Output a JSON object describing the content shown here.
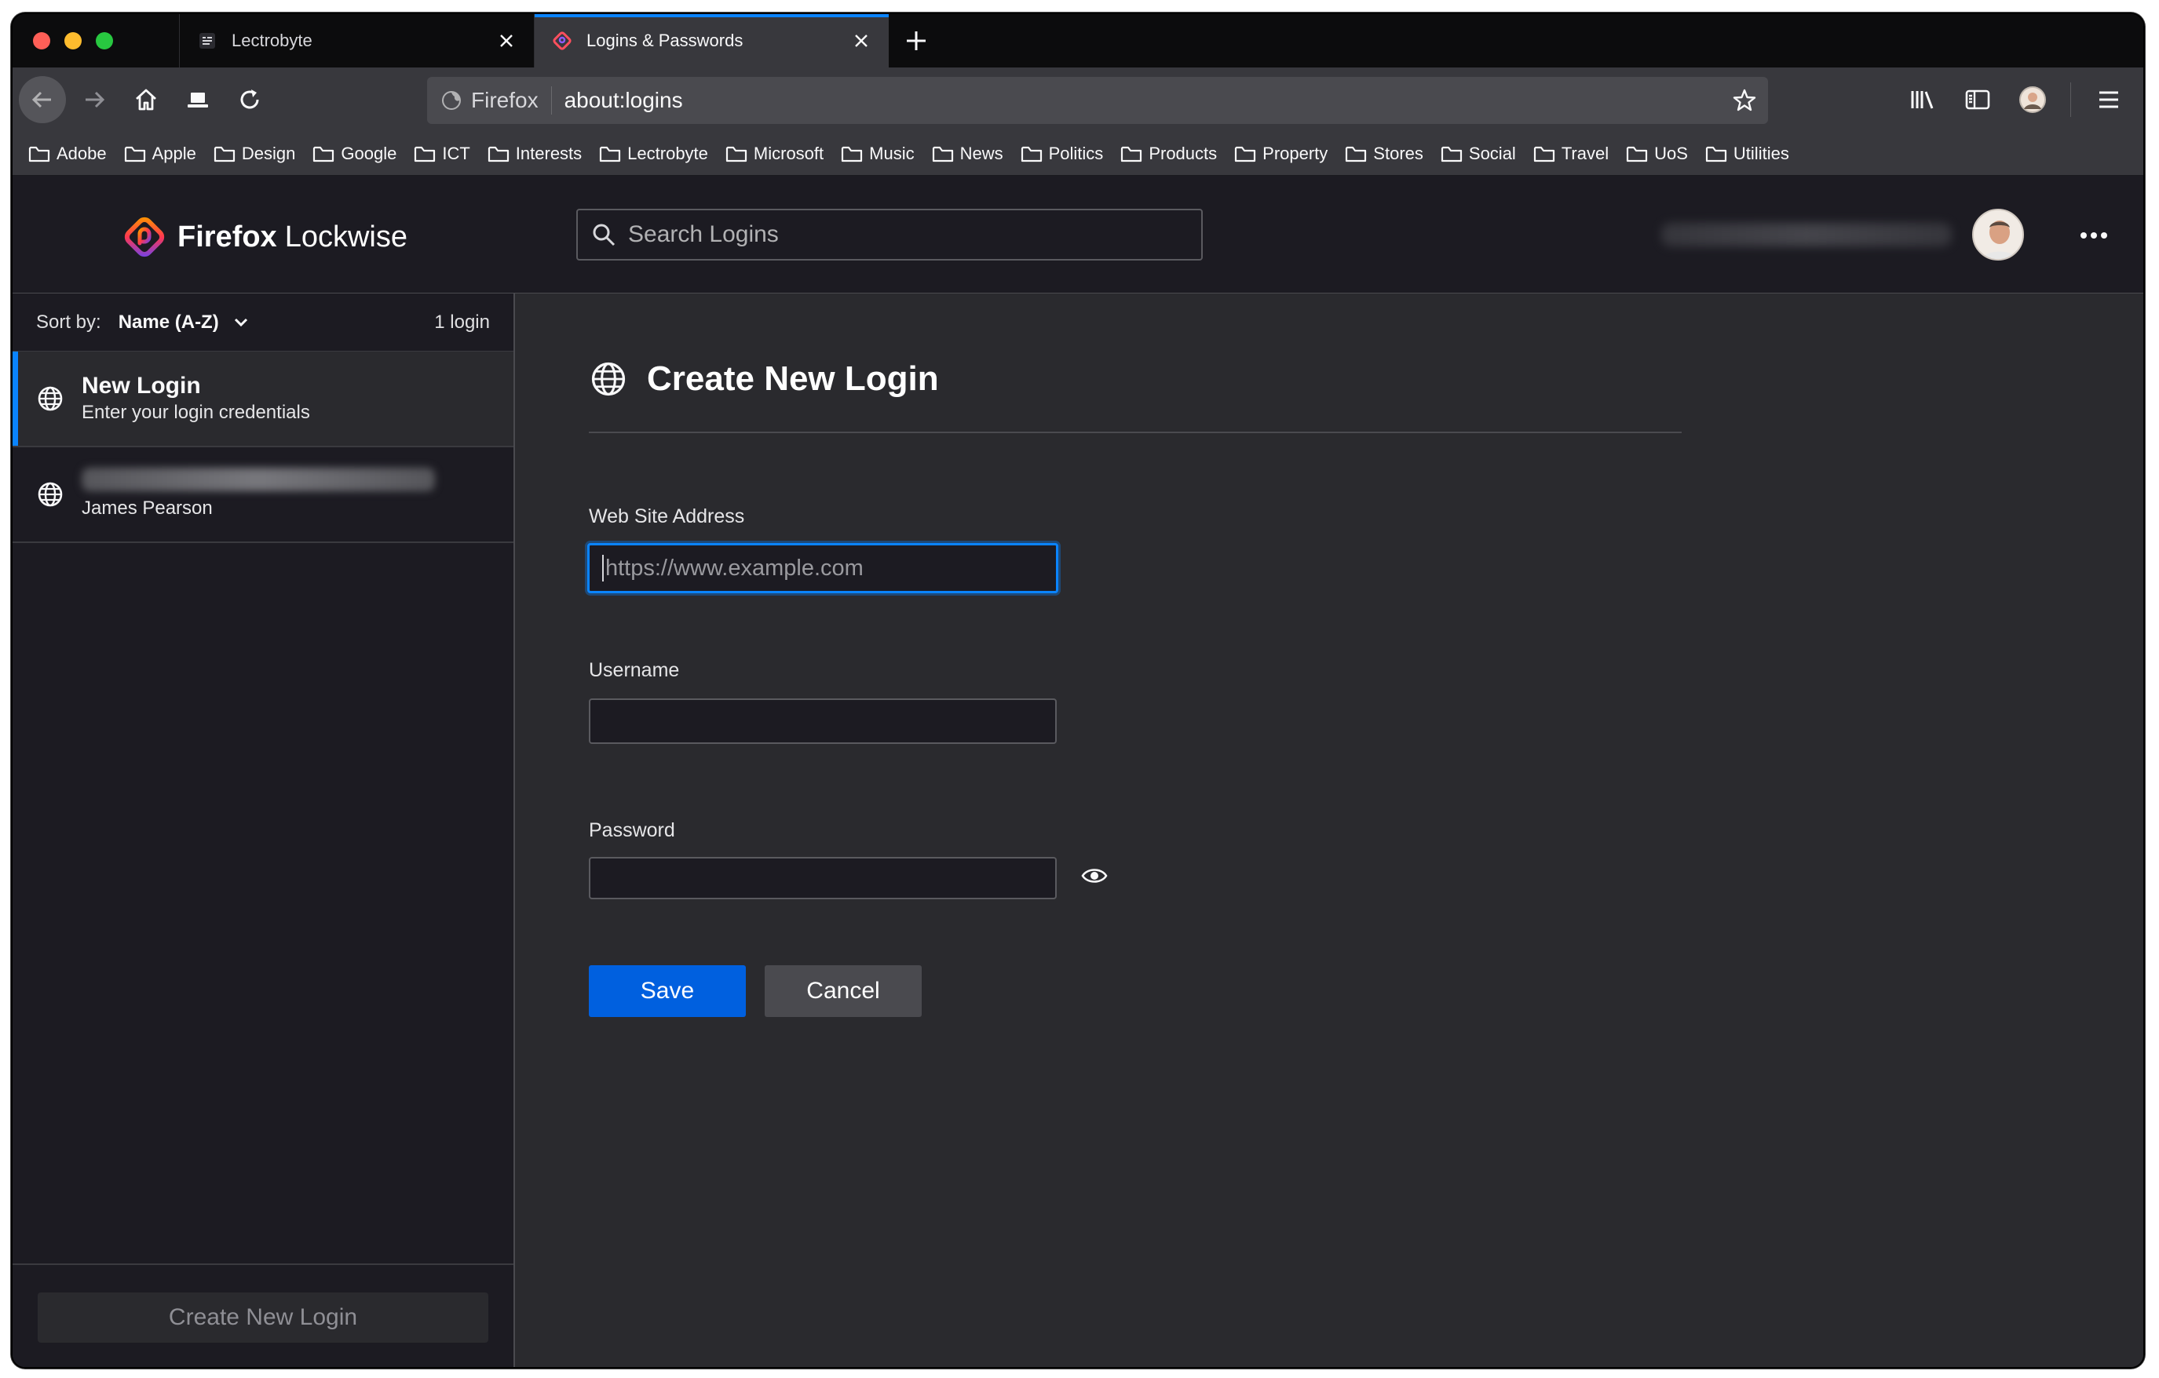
{
  "tabs": [
    {
      "title": "Lectrobyte",
      "active": false
    },
    {
      "title": "Logins & Passwords",
      "active": true
    }
  ],
  "urlbar": {
    "identity": "Firefox",
    "url": "about:logins"
  },
  "bookmarks": [
    "Adobe",
    "Apple",
    "Design",
    "Google",
    "ICT",
    "Interests",
    "Lectrobyte",
    "Microsoft",
    "Music",
    "News",
    "Politics",
    "Products",
    "Property",
    "Stores",
    "Social",
    "Travel",
    "UoS",
    "Utilities"
  ],
  "header": {
    "logo_bold": "Firefox",
    "logo_light": "Lockwise",
    "search_placeholder": "Search Logins"
  },
  "sidebar": {
    "sort_label": "Sort by:",
    "sort_value": "Name (A-Z)",
    "count": "1 login",
    "items": [
      {
        "title": "New Login",
        "subtitle": "Enter your login credentials"
      },
      {
        "title": "",
        "subtitle": "James Pearson"
      }
    ],
    "create_label": "Create New Login"
  },
  "main": {
    "title": "Create New Login",
    "website_label": "Web Site Address",
    "website_placeholder": "https://www.example.com",
    "username_label": "Username",
    "password_label": "Password",
    "save_label": "Save",
    "cancel_label": "Cancel"
  },
  "colors": {
    "accent": "#0a84ff",
    "save_button": "#0060df",
    "page_bg": "#2a2a2e",
    "sidebar_bg": "#1c1b22"
  }
}
